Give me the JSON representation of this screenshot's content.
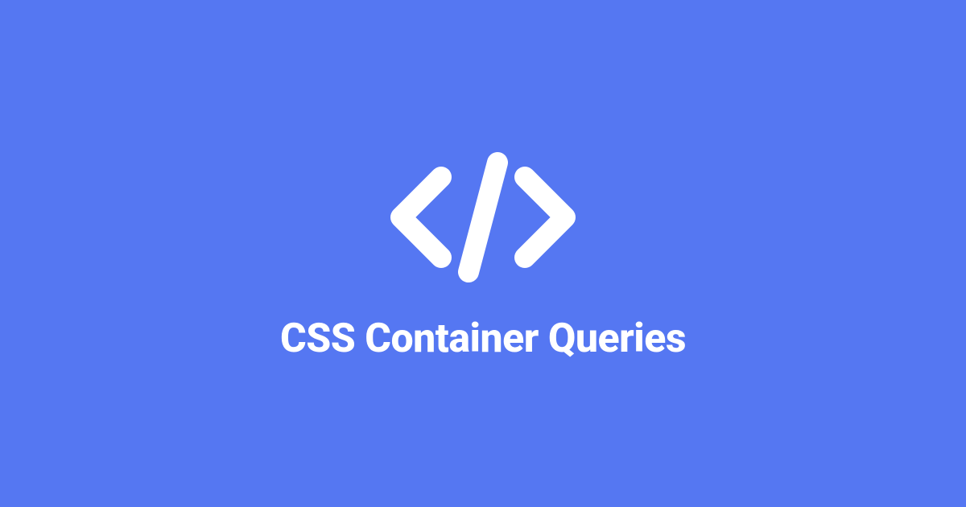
{
  "title": "CSS Container Queries",
  "colors": {
    "background": "#5577f2",
    "foreground": "#ffffff"
  }
}
